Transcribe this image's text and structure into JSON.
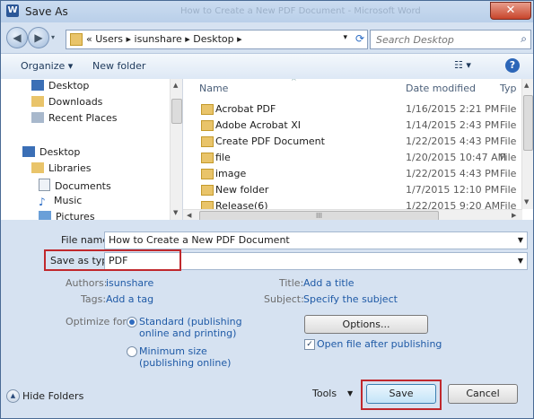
{
  "window": {
    "title": "Save As",
    "faded_title": "How to Create a New PDF Document - Microsoft Word",
    "close_symbol": "✕"
  },
  "address": {
    "crumbs": "« Users ▸ isunshare ▸ Desktop ▸"
  },
  "search": {
    "placeholder": "Search Desktop"
  },
  "toolbar": {
    "organize": "Organize ▾",
    "new_folder": "New folder",
    "views": "☷ ▾",
    "help": "?"
  },
  "nav_pane": {
    "items": [
      {
        "label": "Desktop",
        "icon": "desktop-icon"
      },
      {
        "label": "Downloads",
        "icon": "downloads-icon"
      },
      {
        "label": "Recent Places",
        "icon": "recent-places-icon"
      },
      {
        "label": "Desktop",
        "icon": "desktop-icon"
      },
      {
        "label": "Libraries",
        "icon": "libraries-icon"
      },
      {
        "label": "Documents",
        "icon": "documents-icon"
      },
      {
        "label": "Music",
        "icon": "music-icon"
      },
      {
        "label": "Pictures",
        "icon": "pictures-icon"
      }
    ]
  },
  "file_list": {
    "columns": {
      "name": "Name",
      "date": "Date modified",
      "type": "Typ"
    },
    "rows": [
      {
        "name": "Acrobat PDF",
        "date": "1/16/2015 2:21 PM",
        "type": "File"
      },
      {
        "name": "Adobe Acrobat XI",
        "date": "1/14/2015 2:43 PM",
        "type": "File"
      },
      {
        "name": "Create PDF Document",
        "date": "1/22/2015 4:43 PM",
        "type": "File"
      },
      {
        "name": "file",
        "date": "1/20/2015 10:47 AM",
        "type": "File"
      },
      {
        "name": "image",
        "date": "1/22/2015 4:43 PM",
        "type": "File"
      },
      {
        "name": "New folder",
        "date": "1/7/2015 12:10 PM",
        "type": "File"
      },
      {
        "name": "Release(6)",
        "date": "1/22/2015 9:20 AM",
        "type": "File"
      }
    ],
    "hscroll_mark": "III"
  },
  "form": {
    "file_name_label": "File name:",
    "file_name_value": "How to Create a New PDF Document",
    "save_type_label": "Save as type:",
    "save_type_value": "PDF",
    "authors_label": "Authors:",
    "authors_value": "isunshare",
    "tags_label": "Tags:",
    "tags_value": "Add a tag",
    "title_label": "Title:",
    "title_value": "Add a title",
    "subject_label": "Subject:",
    "subject_value": "Specify the subject",
    "optimize_label": "Optimize for:",
    "optimize_standard_line1": "Standard (publishing",
    "optimize_standard_line2": "online and printing)",
    "optimize_min_line1": "Minimum size",
    "optimize_min_line2": "(publishing online)",
    "options_button": "Options...",
    "open_after_label": "Open file after publishing",
    "open_after_checked": true,
    "highlight_color": "#c0282d"
  },
  "bottom": {
    "hide_folders": "Hide Folders",
    "tools": "Tools",
    "save": "Save",
    "cancel": "Cancel"
  }
}
